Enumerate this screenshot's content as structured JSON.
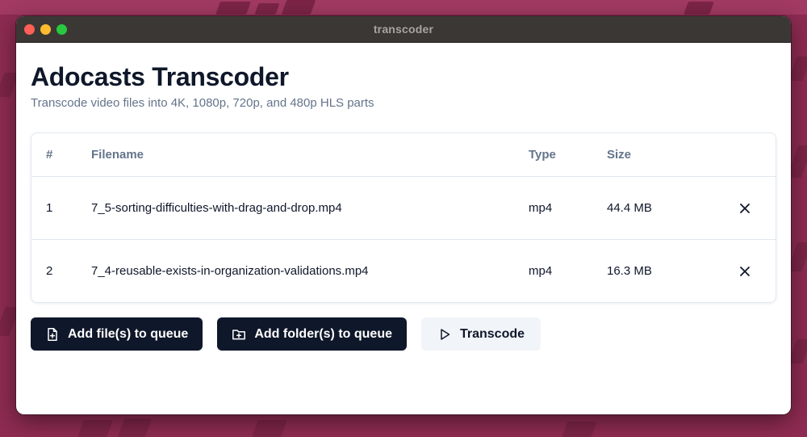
{
  "window": {
    "title": "transcoder"
  },
  "header": {
    "title": "Adocasts Transcoder",
    "subtitle": "Transcode video files into 4K, 1080p, 720p, and 480p HLS parts"
  },
  "table": {
    "columns": {
      "num": "#",
      "filename": "Filename",
      "type": "Type",
      "size": "Size"
    },
    "rows": [
      {
        "num": "1",
        "filename": "7_5-sorting-difficulties-with-drag-and-drop.mp4",
        "type": "mp4",
        "size": "44.4 MB"
      },
      {
        "num": "2",
        "filename": "7_4-reusable-exists-in-organization-validations.mp4",
        "type": "mp4",
        "size": "16.3 MB"
      }
    ]
  },
  "actions": {
    "add_files": "Add file(s) to queue",
    "add_folders": "Add folder(s) to queue",
    "transcode": "Transcode"
  },
  "icons": {
    "remove": "close-icon",
    "add_file": "file-plus-icon",
    "add_folder": "folder-plus-icon",
    "transcode": "play-icon"
  },
  "colors": {
    "background": "#8e2b52",
    "primary_button": "#0f172a",
    "secondary_button": "#f1f5f9",
    "muted_text": "#64748b"
  }
}
